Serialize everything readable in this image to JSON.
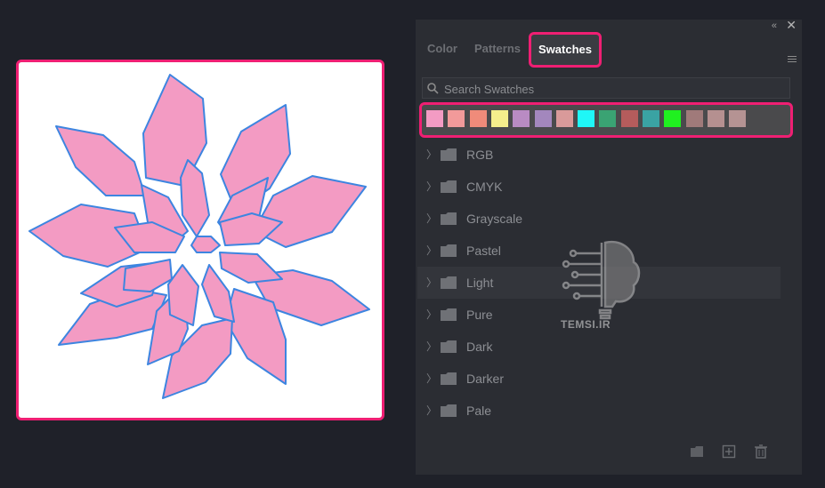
{
  "panel": {
    "tabs": [
      "Color",
      "Patterns",
      "Swatches"
    ],
    "active_tab": "Swatches",
    "search_placeholder": "Search Swatches",
    "swatches": [
      "#f39bc3",
      "#f29a9a",
      "#f08b7a",
      "#f5ee8c",
      "#b98bc3",
      "#a387bd",
      "#d99a9a",
      "#1ff7f7",
      "#3aa373",
      "#b55c5c",
      "#3aa3a3",
      "#20f020",
      "#a07a7a",
      "#b59090",
      "#b59393"
    ],
    "folders": [
      "RGB",
      "CMYK",
      "Grayscale",
      "Pastel",
      "Light",
      "Pure",
      "Dark",
      "Darker",
      "Pale"
    ],
    "selected_folder": "Light"
  },
  "watermark": {
    "text": "TEMSI.IR"
  },
  "colors": {
    "highlight": "#ef1f73",
    "petal_fill": "#f39bc3",
    "petal_stroke": "#3d85e0"
  }
}
